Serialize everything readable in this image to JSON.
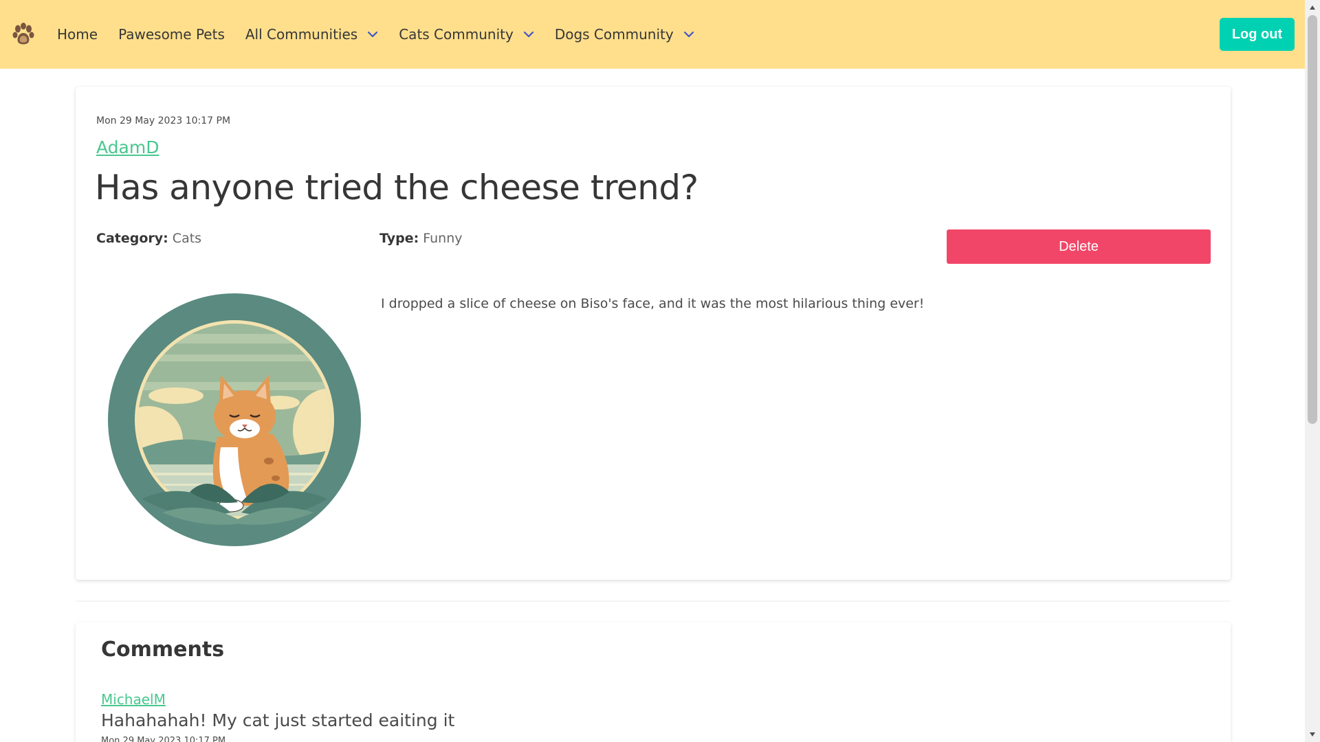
{
  "nav": {
    "logo_icon": "paw-icon",
    "home": "Home",
    "pawesome_pets": "Pawesome Pets",
    "all_communities": "All Communities",
    "cats_community": "Cats Community",
    "dogs_community": "Dogs Community",
    "logout": "Log out",
    "accent_color": "#ffdf8c",
    "logout_color": "#00d1b2"
  },
  "post": {
    "date": "Mon 29 May 2023 10:17 PM",
    "author": "AdamD",
    "title": "Has anyone tried the cheese trend?",
    "category_label": "Category:",
    "category_value": "Cats",
    "type_label": "Type:",
    "type_value": "Funny",
    "delete_label": "Delete",
    "delete_color": "#f14668",
    "body": "I dropped a slice of cheese on Biso's face, and it was the most hilarious thing ever!",
    "image_icon": "cat-illustration"
  },
  "comments": {
    "title": "Comments",
    "items": [
      {
        "author": "MichaelM",
        "text": "Hahahahah! My cat just started eaiting it",
        "date": "Mon 29 May 2023 10:17 PM"
      }
    ]
  }
}
